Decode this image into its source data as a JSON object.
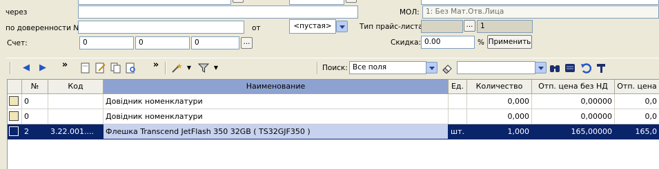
{
  "form": {
    "via_label": "через",
    "proxy_label": "по доверенности №",
    "from_label": "от",
    "date_value": "<пустая>",
    "account_label": "Счет:",
    "account_values": [
      "0",
      "0",
      "0"
    ],
    "mol_label": "МОЛ:",
    "mol_value": "1: Без Мат.Отв.Лица",
    "pricelist_label": "Тип прайс-листа:",
    "pricelist_value": "1",
    "discount_label": "Скидка:",
    "discount_value": "0.00",
    "percent_sign": "%",
    "apply_label": "Применить",
    "ellipsis": "..."
  },
  "toolbar": {
    "search_label": "Поиск:",
    "search_field_value": "Все поля",
    "search_text_value": "",
    "overflow": "»"
  },
  "table": {
    "columns": [
      "",
      "№",
      "Код",
      "Наименование",
      "Ед.",
      "Количество",
      "Отп. цена без НД",
      "Отп. цена"
    ],
    "rows": [
      {
        "no": "0",
        "code": "",
        "name": "Довідник номенклатури",
        "unit": "",
        "qty": "0,000",
        "price": "0,00000",
        "price2": "0,0"
      },
      {
        "no": "0",
        "code": "",
        "name": "Довідник номенклатури",
        "unit": "",
        "qty": "0,000",
        "price": "0,00000",
        "price2": "0,0"
      },
      {
        "no": "2",
        "code": "3.22.001....",
        "name": "Флешка Transcend JetFlash 350 32GB ( TS32GJF350 )",
        "unit": "шт.",
        "qty": "1,000",
        "price": "165,00000",
        "price2": "165,0"
      }
    ]
  }
}
